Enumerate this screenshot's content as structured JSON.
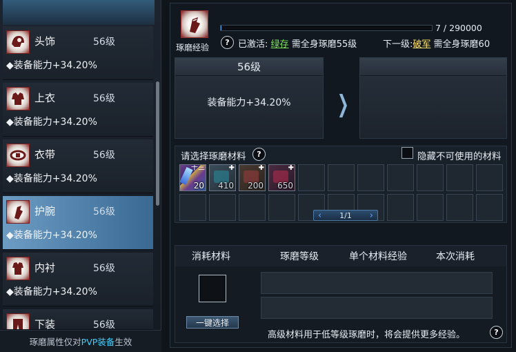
{
  "left_panel": {
    "slots": [
      {
        "name": "头饰",
        "level": "56级",
        "stat": "◆装备能力+34.20%",
        "icon": "helmet-icon"
      },
      {
        "name": "上衣",
        "level": "56级",
        "stat": "◆装备能力+34.20%",
        "icon": "coat-icon"
      },
      {
        "name": "衣带",
        "level": "56级",
        "stat": "◆装备能力+34.20%",
        "icon": "belt-icon"
      },
      {
        "name": "护腕",
        "level": "56级",
        "stat": "◆装备能力+34.20%",
        "icon": "bracer-icon",
        "active": true
      },
      {
        "name": "内衬",
        "level": "56级",
        "stat": "◆装备能力+34.20%",
        "icon": "inner-shirt-icon"
      },
      {
        "name": "下装",
        "level": "56级",
        "stat": "",
        "icon": "pants-icon"
      }
    ],
    "footer_prefix": "琢磨属性仅对",
    "footer_highlight": "PVP装备",
    "footer_suffix": "生效"
  },
  "right_panel": {
    "exp_label": "琢磨经验",
    "exp_text": "7 / 290000",
    "exp_fraction": 2.41e-05,
    "activated_prefix": "已激活:",
    "activated_name": "绿存",
    "activated_req": "需全身琢磨55级",
    "next_prefix": "下一级:",
    "next_name": "破军",
    "next_req": "需全身琢磨60",
    "current_card": {
      "title": "56级",
      "stat": "装备能力+34.20%"
    },
    "next_card": {
      "title": "",
      "stat": ""
    },
    "materials": {
      "title": "请选择琢磨材料",
      "hide_label": "隐藏不可使用的材料",
      "items": [
        {
          "count": "20",
          "corner": "十三",
          "icon": "crystal-icon"
        },
        {
          "count": "410",
          "corner": "✚",
          "icon": "material-icon"
        },
        {
          "count": "200",
          "corner": "✚",
          "icon": "material-icon"
        },
        {
          "count": "650",
          "corner": "✚",
          "icon": "material-icon"
        }
      ],
      "page": "1/1"
    },
    "consume": {
      "col_material": "消耗材料",
      "col_level": "琢磨等级",
      "col_exp": "单个材料经验",
      "col_cost": "本次消耗",
      "one_key": "一键选择",
      "tip": "高级材料用于低等级琢磨时，将会提供更多经验。"
    }
  }
}
